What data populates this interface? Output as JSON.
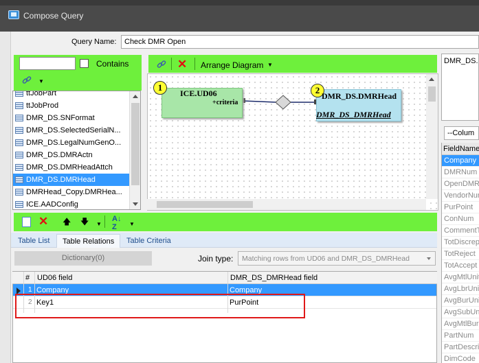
{
  "window": {
    "title": "Compose Query"
  },
  "query": {
    "name_label": "Query Name:",
    "name_value": "Check DMR Open"
  },
  "table_search": {
    "value": "",
    "contains_label": "Contains"
  },
  "table_list": {
    "items": [
      "ttJobPart",
      "ttJobProd",
      "DMR_DS.SNFormat",
      "DMR_DS.SelectedSerialN...",
      "DMR_DS.LegalNumGenO...",
      "DMR_DS.DMRActn",
      "DMR_DS.DMRHeadAttch",
      "DMR_DS.DMRHead",
      "DMRHead_Copy.DMRHea...",
      "ICE.AADConfig"
    ],
    "selected": "DMR_DS.DMRHead"
  },
  "diagram_toolbar": {
    "arrange_label": "Arrange Diagram"
  },
  "diagram": {
    "node1": {
      "badge": "1",
      "title": "ICE.UD06",
      "field": "+criteria"
    },
    "node2": {
      "badge": "2",
      "title": "DMR_DS.DMRHead",
      "alias": "DMR_DS_DMRHead"
    }
  },
  "right_panel": {
    "table_name": "DMR_DS.D",
    "column_select": "--Colum",
    "field_header": "FieldName",
    "fields": [
      "Company",
      "DMRNum",
      "OpenDMR",
      "VendorNum",
      "PurPoint",
      "ConNum",
      "CommentT",
      "TotDiscrep",
      "TotReject",
      "TotAccept",
      "AvgMtlUnit",
      "AvgLbrUnit",
      "AvgBurUnit",
      "AvgSubUnit",
      "AvgMtlBur",
      "PartNum",
      "PartDescri",
      "DimCode"
    ],
    "selected_field": "Company"
  },
  "tabs": {
    "table_list": "Table List",
    "table_relations": "Table Relations",
    "table_criteria": "Table Criteria"
  },
  "relations": {
    "dictionary_label": "Dictionary(0)",
    "join_label": "Join type:",
    "join_value": "Matching rows  from UD06 and DMR_DS_DMRHead",
    "col_num": "#",
    "col_left": "UD06 field",
    "col_right": "DMR_DS_DMRHead  field",
    "rows": [
      {
        "num": "1",
        "left": "Company",
        "right": "Company"
      },
      {
        "num": "2",
        "left": "Key1",
        "right": "PurPoint"
      }
    ]
  },
  "colors": {
    "toolbar_green": "#6ef03c",
    "selection_blue": "#3399ff",
    "annotation_red": "#e01818"
  }
}
